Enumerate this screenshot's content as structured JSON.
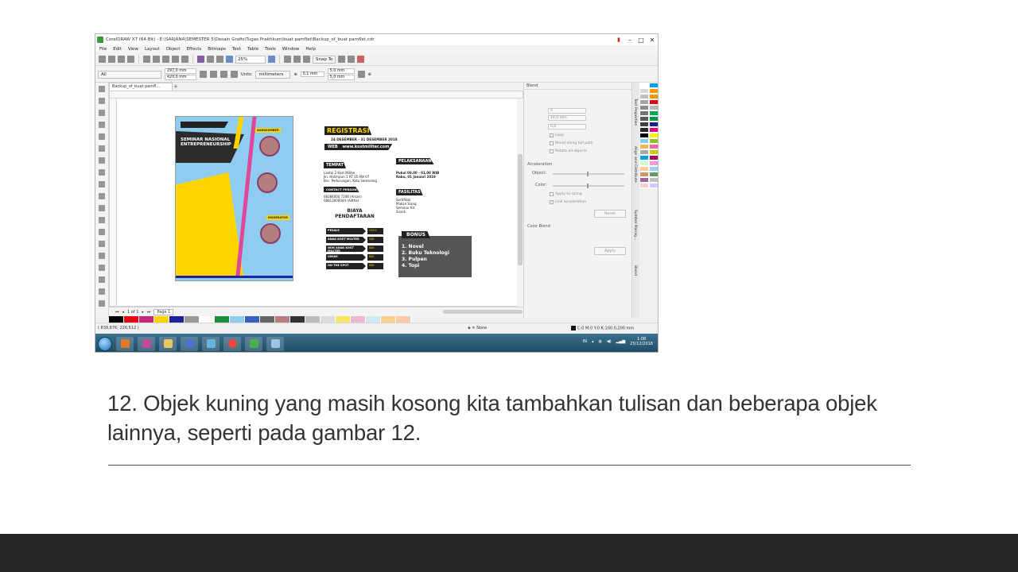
{
  "window": {
    "title": "CorelDRAW X7 (64-Bit) - E:\\SARJANA\\SEMESTER 5\\Desain Grafis\\Tugas Praktikum\\buat pamflet\\Backup_of_buat pamflet.cdr",
    "controls": {
      "minimize": "–",
      "maximize": "□",
      "close": "✕"
    }
  },
  "menu": [
    "File",
    "Edit",
    "View",
    "Layout",
    "Object",
    "Effects",
    "Bitmaps",
    "Text",
    "Table",
    "Tools",
    "Window",
    "Help"
  ],
  "toolbar": {
    "zoom": "25%",
    "snap_to": "Snap To"
  },
  "property_bar": {
    "preset": "All",
    "width": "297,0 mm",
    "height": "420,0 mm",
    "units_label": "Units:",
    "units_value": "millimeters",
    "nudge": "0,1 mm",
    "dup_x": "5,0 mm",
    "dup_y": "5,0 mm"
  },
  "document_tab": "Backup_of_buat pamfl...",
  "poster": {
    "seminar_title": "SEMINAR NASIONAL ENTREPRENEURSHIP",
    "tag_speaker": "NARASUMBER",
    "tag_moderator": "MODERATOR"
  },
  "flyer": {
    "registrasi": "REGISTRASI",
    "date_range": "24 DESEMBER - 31 DESEMBER 2018",
    "web_label": "WEB",
    "web_url": "www.kostmiliter.com",
    "tempat_label": "TEMPAT",
    "tempat_text": "Lantai 2 Kost Militer\nJln. Halimpuri 1 RT 05 RW 07\nKec. Pedurungan, Kota Semarang",
    "contact_label": "CONTACT PERSON",
    "contact_text": "08384000 7208 (Arsan)\n08813000044 (Adtha)",
    "pelaksanaan_label": "PELAKSANAAN",
    "pelaksanaan_text": "Pukul 08.00 - 01.00 WIB\nRabu, 01 Januari 2019",
    "fasilitas_label": "FASILITAS",
    "fasilitas_text": "Sertifikat\nMakan Siang\nSeminar Kit\nSnack",
    "biaya_title": "BIAYA PENDAFTARAN",
    "prices": [
      {
        "label": "PESALE",
        "value": "150 K"
      },
      {
        "label": "ANAK KOST MILITER",
        "value": "50K"
      },
      {
        "label": "NON ANAK KOST MILITER",
        "value": "80K"
      },
      {
        "label": "UMUM",
        "value": "80K"
      },
      {
        "label": "ON THE SPOT",
        "value": "80K"
      }
    ],
    "bonus_title": "BONUS",
    "bonus_items": [
      "1. Novel",
      "2. Buku Teknologi",
      "3. Pulpen",
      "4. Topi"
    ]
  },
  "page_nav": {
    "page_count": "1 of 1",
    "page_tab": "Page 1"
  },
  "status": {
    "coords": "( 839,876; 226,512 )",
    "fill": "None",
    "outline": "C:0 M:0 Y:0 K:100  0,200 mm"
  },
  "docker": {
    "title": "Blend",
    "steps": "4",
    "spacing": "10,0 mm",
    "rotation": "0,0",
    "loop": "Loop",
    "blend_path": "Blend along full path",
    "rotate_all": "Rotate all objects",
    "acceleration": "Acceleration",
    "object": "Object:",
    "color": "Color:",
    "apply_sizing": "Apply to sizing",
    "link_acceleration": "Link acceleration",
    "reset": "Reset",
    "color_blend": "Color Blend",
    "apply": "Apply"
  },
  "side_tabs": [
    "Text Properties",
    "Align and Distribute",
    "Symbol Manag...",
    "Blend"
  ],
  "taskbar": {
    "lang": "IN",
    "time": "1:08",
    "date": "25/12/2018"
  },
  "slide": {
    "caption": "12. Objek kuning yang masih kosong kita tambahkan tulisan dan beberapa objek lainnya, seperti pada gambar 12."
  },
  "colors": {
    "yellow": "#ffd400",
    "poster_blue": "#8fcdf0",
    "dark": "#222222",
    "footer": "#262626"
  }
}
